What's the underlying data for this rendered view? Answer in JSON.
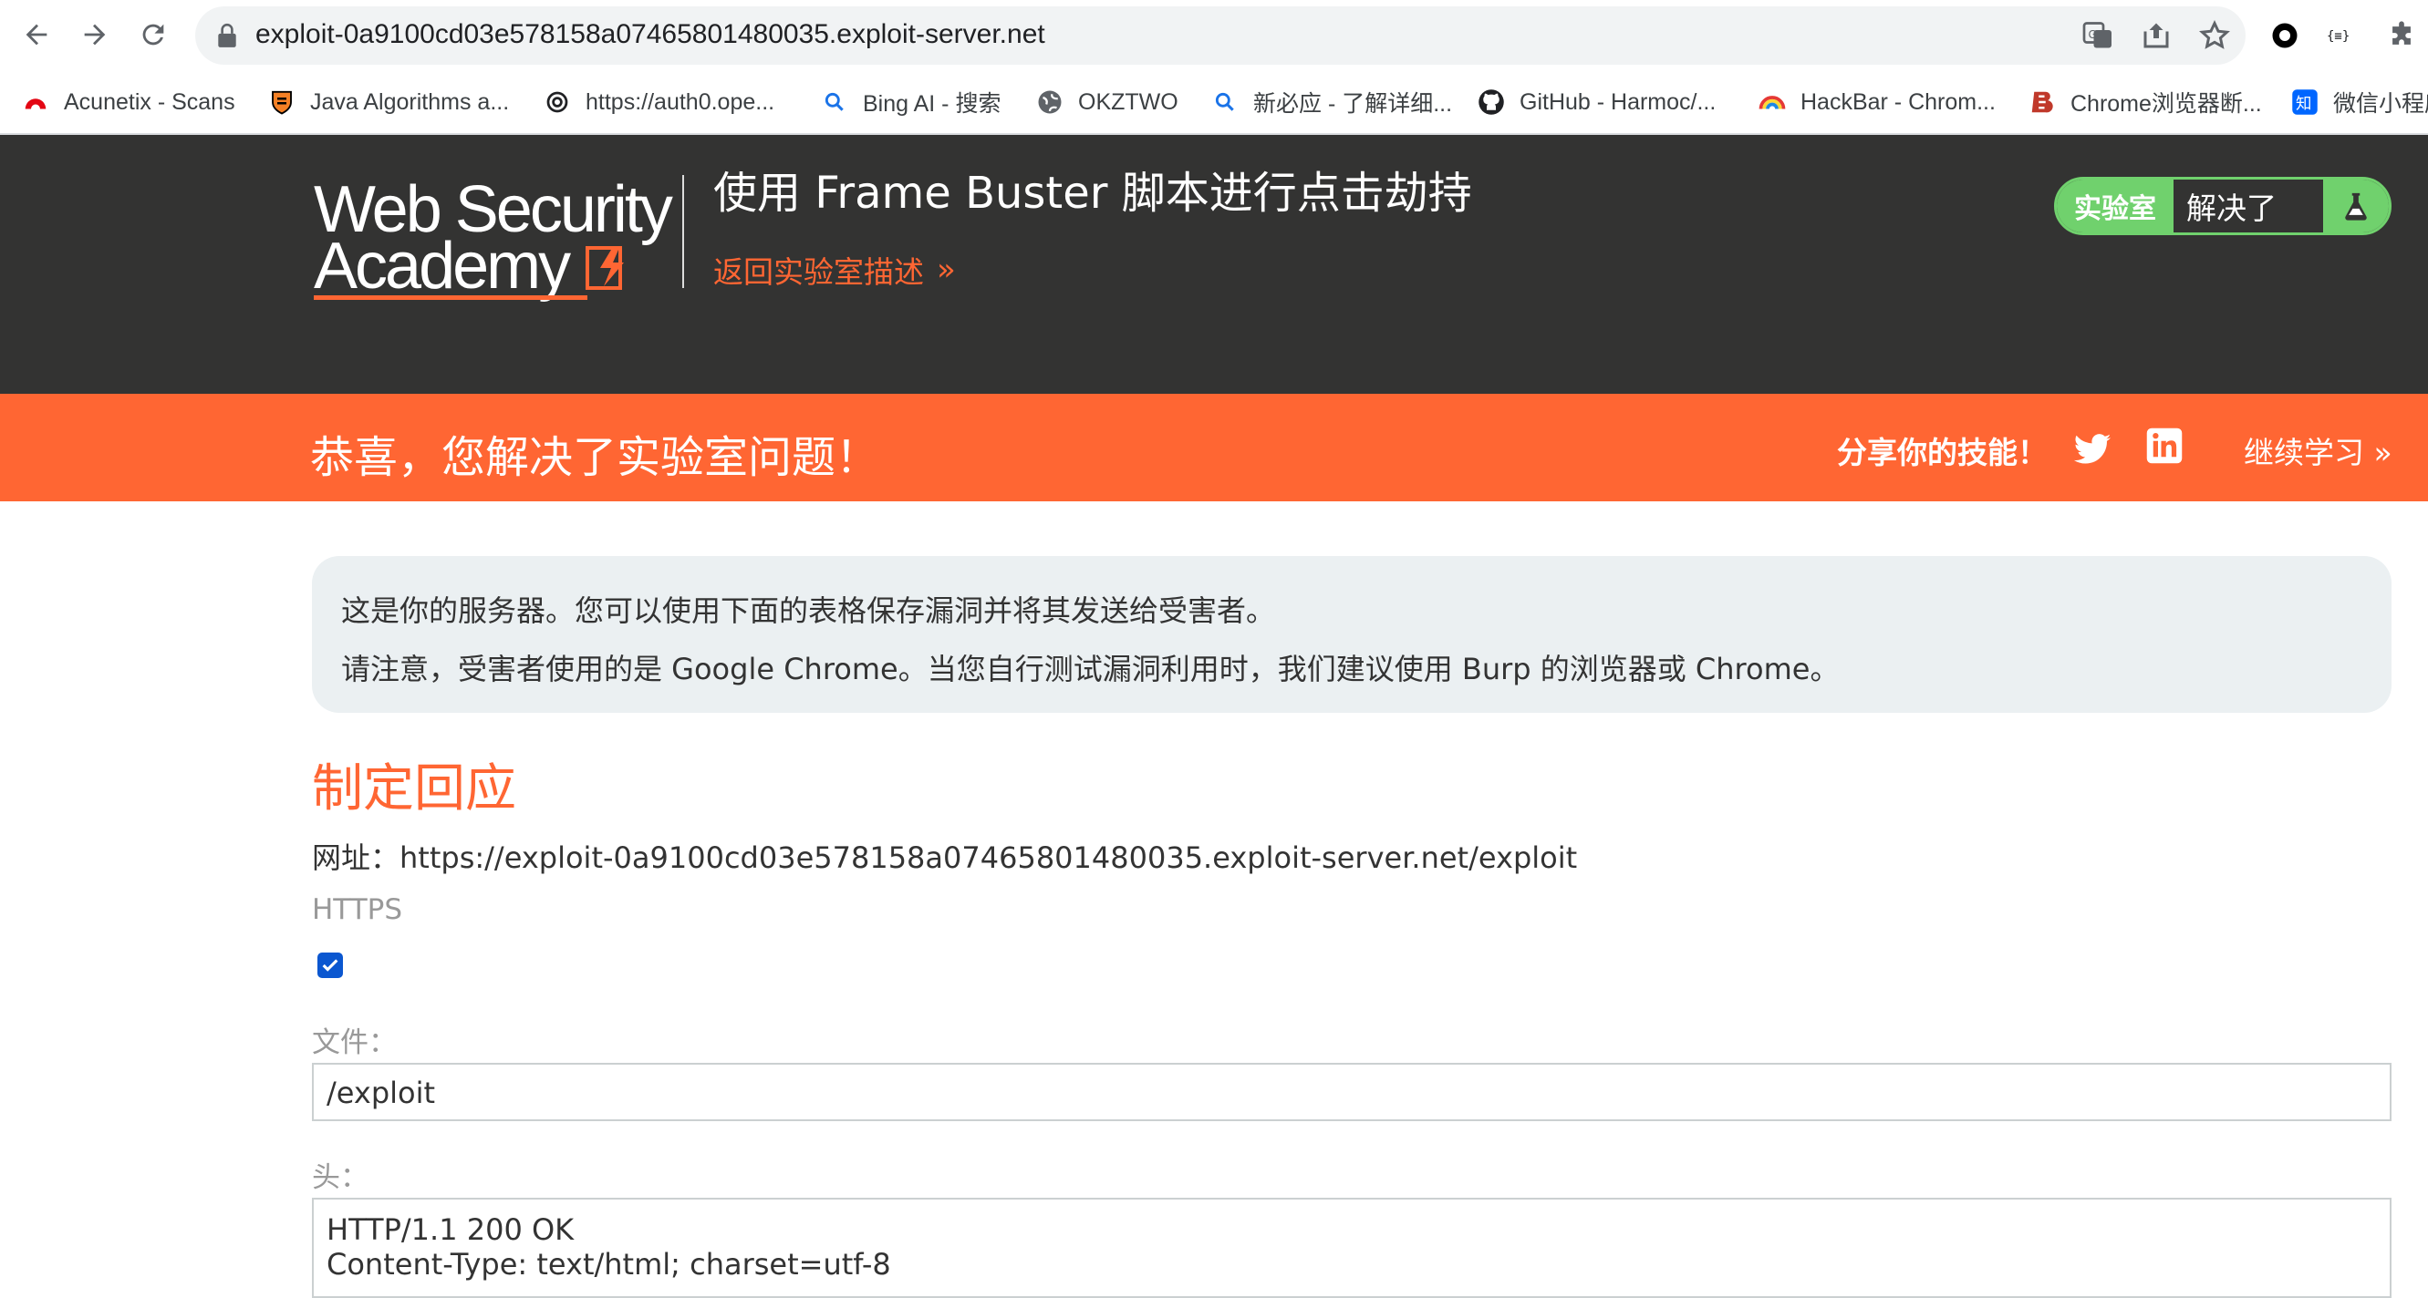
{
  "browser": {
    "url": "exploit-0a9100cd03e578158a07465801480035.exploit-server.net",
    "bookmarks": [
      {
        "label": "Acunetix - Scans",
        "icon": "acunetix-icon"
      },
      {
        "label": "Java Algorithms a...",
        "icon": "princeton-shield-icon"
      },
      {
        "label": "https://auth0.ope...",
        "icon": "openai-icon"
      },
      {
        "label": "Bing AI - 搜索",
        "icon": "search-icon"
      },
      {
        "label": "OKZTWO",
        "icon": "globe-icon"
      },
      {
        "label": "新必应 - 了解详细...",
        "icon": "search-icon"
      },
      {
        "label": "GitHub - Harmoc/...",
        "icon": "github-icon"
      },
      {
        "label": "HackBar - Chrom...",
        "icon": "hackbar-icon"
      },
      {
        "label": "Chrome浏览器断...",
        "icon": "b-logo-icon"
      },
      {
        "label": "微信小程序",
        "icon": "zhihu-icon"
      }
    ]
  },
  "lab": {
    "logo_line1": "Web Security",
    "logo_line2": "Academy",
    "title": "使用 Frame Buster 脚本进行点击劫持",
    "back_link": "返回实验室描述",
    "status_label": "实验室",
    "status_value": "解决了"
  },
  "banner": {
    "message": "恭喜，您解决了实验室问题！",
    "share": "分享你的技能！",
    "continue": "继续学习"
  },
  "info": {
    "line1": "这是你的服务器。您可以使用下面的表格保存漏洞并将其发送给受害者。",
    "line2": "请注意，受害者使用的是 Google Chrome。当您自行测试漏洞利用时，我们建议使用 Burp 的浏览器或 Chrome。"
  },
  "form": {
    "heading": "制定回应",
    "url_line": "网址：https://exploit-0a9100cd03e578158a07465801480035.exploit-server.net/exploit",
    "https_label": "HTTPS",
    "https_checked": true,
    "file_label": "文件：",
    "file_value": "/exploit",
    "head_label": "头：",
    "head_line1": "HTTP/1.1 200 OK",
    "head_line2": "Content-Type: text/html; charset=utf-8"
  },
  "colors": {
    "header_bg": "#333332",
    "accent": "#ff6633",
    "solved_green": "#70d16d",
    "info_bg": "#ebf0f2"
  }
}
